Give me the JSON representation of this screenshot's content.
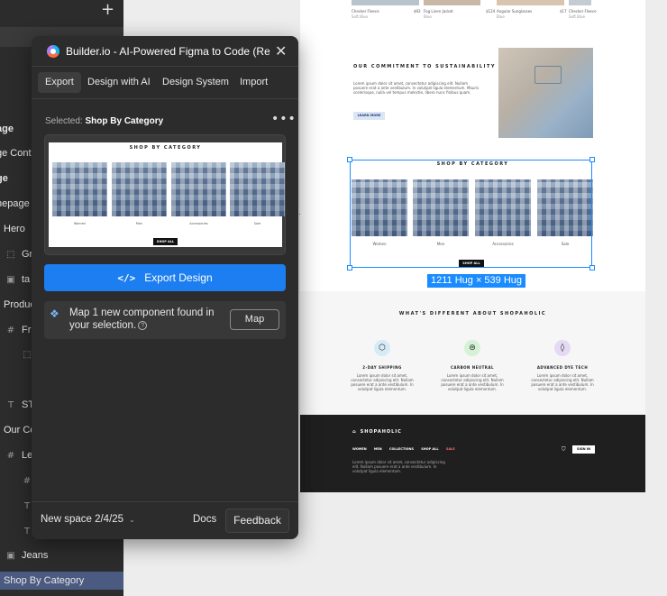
{
  "layers": {
    "items": [
      {
        "label": "age",
        "icon": ""
      },
      {
        "label": "ge Cont",
        "icon": ""
      },
      {
        "label": "ge",
        "icon": ""
      },
      {
        "label": "nepage",
        "icon": ""
      },
      {
        "label": "Hero",
        "icon": ""
      },
      {
        "label": "Gr",
        "icon": "frame"
      },
      {
        "label": "ta",
        "icon": "image"
      },
      {
        "label": "Produc",
        "icon": ""
      },
      {
        "label": "Fr",
        "icon": "hash"
      },
      {
        "label": "",
        "icon": "frame"
      },
      {
        "label": "ST",
        "icon": "text"
      },
      {
        "label": "Our Co",
        "icon": ""
      },
      {
        "label": "Le",
        "icon": "hash"
      },
      {
        "label": "",
        "icon": "hash"
      },
      {
        "label": "",
        "icon": "text"
      },
      {
        "label": "",
        "icon": "text"
      },
      {
        "label": "Jeans",
        "icon": "image"
      },
      {
        "label": "Shop By Category",
        "icon": ""
      }
    ]
  },
  "canvas": {
    "products": [
      {
        "name": "Checker Fleece",
        "price": "$92",
        "sub": "Soft Blue"
      },
      {
        "name": "Fog Linen Jacket",
        "price": "$124",
        "sub": "Blue"
      },
      {
        "name": "Angular Sunglasses",
        "price": "$17",
        "sub": "Blue"
      },
      {
        "name": "Checker Fleece",
        "price": "",
        "sub": "Soft Blue"
      }
    ],
    "sustainability": {
      "title": "OUR COMMITMENT TO SUSTAINABILITY",
      "body": "Lorem ipsum dolor sit amet, consectetur adipiscing elit. Nullam posuere erat a ante vestibulum. In volutpat ligula elementum. Mauris scelerisque, nulla vel tempus molestie, libero nunc finibus quam.",
      "button": "LEARN MORE"
    },
    "category": {
      "title": "SHOP BY CATEGORY",
      "labels": [
        "Women",
        "Men",
        "Accessories",
        "Sale"
      ],
      "button": "SHOP ALL"
    },
    "selection_size": "1211 Hug × 539 Hug",
    "different": {
      "title": "WHAT'S DIFFERENT ABOUT SHOPAHOLIC",
      "features": [
        {
          "title": "2-DAY SHIPPING",
          "body": "Lorem ipsum dolor sit amet, consectetur adipiscing elit. Nullam posuere erat a ante vestibulum. In volutpat ligula elementum.",
          "icon": "box-icon",
          "color": "#d6ebf6"
        },
        {
          "title": "CARBON NEUTRAL",
          "body": "Lorem ipsum dolor sit amet, consectetur adipiscing elit. Nullam posuere erat a ante vestibulum. In volutpat ligula elementum.",
          "icon": "globe-icon",
          "color": "#d6f2d6"
        },
        {
          "title": "ADVANCED DYE TECH",
          "body": "Lorem ipsum dolor sit amet, consectetur adipiscing elit. Nullam posuere erat a ante vestibulum. In volutpat ligula elementum.",
          "icon": "drop-icon",
          "color": "#e6d9f5"
        }
      ]
    },
    "footer": {
      "logo": "SHOPAHOLIC",
      "nav": [
        "WOMEN",
        "MEN",
        "COLLECTIONS",
        "SHOP ALL",
        "SALE"
      ],
      "body": "Lorem ipsum dolor sit amet, consectetur adipiscing elit. Nullam posuere erat a ante vestibulum. In volutpat ligula elementum.",
      "signin": "SIGN IN"
    }
  },
  "plugin": {
    "title": "Builder.io - AI-Powered Figma to Code (React, ...",
    "tabs": [
      "Export",
      "Design with AI",
      "Design System",
      "Import"
    ],
    "active_tab": "Export",
    "selected_prefix": "Selected:",
    "selected_name": "Shop By Category",
    "preview": {
      "title": "SHOP BY CATEGORY",
      "labels": [
        "Women",
        "Men",
        "Accessories",
        "Sale"
      ],
      "button": "SHOP ALL"
    },
    "export_label": "Export Design",
    "map_text": "Map 1 new component found in your selection.",
    "map_button": "Map",
    "space": "New space 2/4/25",
    "docs": "Docs",
    "feedback": "Feedback",
    "accent": "#1c7ef0"
  }
}
